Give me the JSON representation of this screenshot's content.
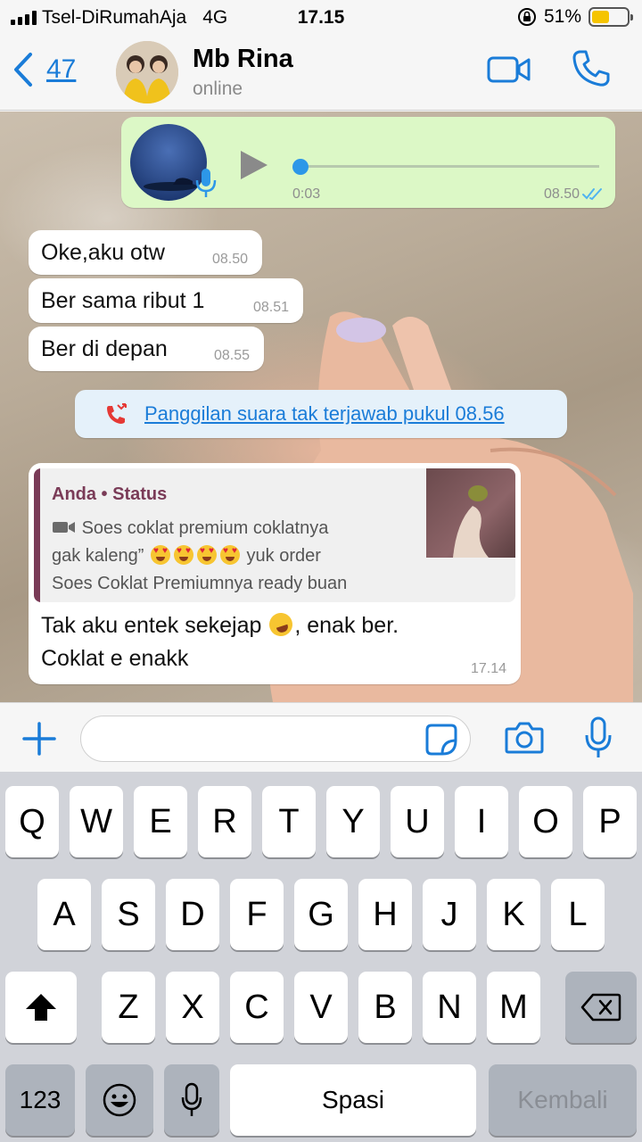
{
  "status_bar": {
    "carrier": "Tsel-DiRumahAja",
    "network": "4G",
    "time": "17.15",
    "battery": "51%",
    "battery_level": 0.51
  },
  "header": {
    "back_count": "47",
    "contact_name": "Mb Rina",
    "contact_status": "online",
    "icons": [
      "back-chevron-icon",
      "video-call-icon",
      "phone-icon"
    ]
  },
  "messages": {
    "voice": {
      "duration": "0:03",
      "time": "08.50",
      "progress": 0.0
    },
    "incoming": [
      {
        "text": "Oke,aku otw",
        "time": "08.50"
      },
      {
        "text": "Ber sama ribut 1",
        "time": "08.51"
      },
      {
        "text": "Ber di depan",
        "time": "08.55"
      }
    ],
    "missed_call": "Panggilan suara tak terjawab pukul 08.56",
    "reply": {
      "quote_title": "Anda • Status",
      "quote_line1": "Soes coklat premium coklatnya",
      "quote_line2a": "gak kaleng”",
      "quote_line2b": "yuk order",
      "quote_line3": "Soes Coklat Premiumnya ready buan",
      "text_part1": "Tak aku entek sekejap",
      "text_part2": ", enak ber.",
      "text_line2": "Coklat e enakk",
      "time": "17.14"
    }
  },
  "input": {
    "placeholder": ""
  },
  "keyboard": {
    "row1": [
      "Q",
      "W",
      "E",
      "R",
      "T",
      "Y",
      "U",
      "I",
      "O",
      "P"
    ],
    "row2": [
      "A",
      "S",
      "D",
      "F",
      "G",
      "H",
      "J",
      "K",
      "L"
    ],
    "row3": [
      "Z",
      "X",
      "C",
      "V",
      "B",
      "N",
      "M"
    ],
    "numbers_key": "123",
    "space_key": "Spasi",
    "return_key": "Kembali"
  },
  "colors": {
    "accent": "#1a7cd8",
    "outgoing_bubble": "#dcf8c6",
    "quote_accent": "#7a3b57",
    "missed_call": "#e53935"
  }
}
